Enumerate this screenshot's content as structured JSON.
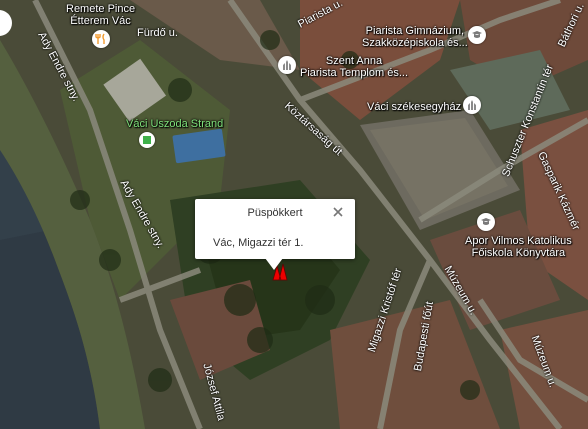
{
  "map": {
    "type": "satellite"
  },
  "popup": {
    "title": "Püspökkert",
    "address": "Vác, Migazzi tér 1."
  },
  "places": [
    {
      "id": "remete",
      "lines": [
        "Remete Pince",
        "Étterem Vác"
      ],
      "icon": "restaurant-icon"
    },
    {
      "id": "piarista-gimn",
      "lines": [
        "Piarista Gimnázium,",
        "Szakközépiskola és..."
      ],
      "icon": "school-icon"
    },
    {
      "id": "szent-anna",
      "lines": [
        "Szent Anna",
        "Piarista Templom és..."
      ],
      "icon": "church-icon"
    },
    {
      "id": "szekesegyhaz",
      "lines": [
        "Váci székesegyház"
      ],
      "icon": "church-icon"
    },
    {
      "id": "uszoda",
      "lines": [
        "Váci Uszoda Strand"
      ],
      "icon": "pool-marker-icon"
    },
    {
      "id": "apor",
      "lines": [
        "Apor Vilmos Katolikus",
        "Főiskola Könyvtára"
      ],
      "icon": "school-icon"
    }
  ],
  "streets": {
    "furdo": "Fürdő u.",
    "piarista": "Piarista u.",
    "bathori": "Báthori u.",
    "ady1": "Ady Endre stny.",
    "ady2": "Ady Endre stny.",
    "koztarsasag": "Köztársaság út",
    "schuszter": "Schuszter Konstantin tér",
    "gasparik": "Gasparik Kázmér",
    "migazzi": "Migazzi Kristóf tér",
    "budapesti": "Budapesti főút",
    "muzeum1": "Múzeum u.",
    "muzeum2": "Múzeum u.",
    "jozsef": "József Attila"
  }
}
